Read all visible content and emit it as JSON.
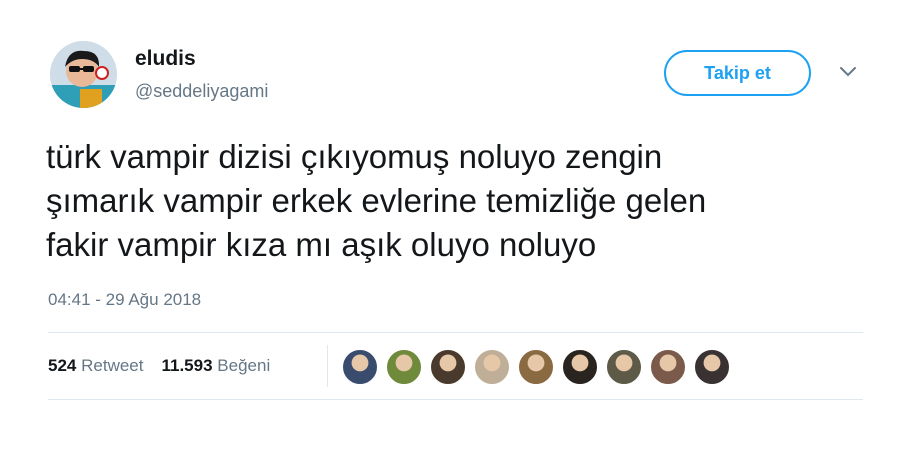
{
  "user": {
    "name": "eludis",
    "handle": "@seddeliyagami"
  },
  "follow_label": "Takip et",
  "tweet": {
    "lines": [
      "türk vampir dizisi çıkıyomuş noluyo zengin",
      "şımarık vampir erkek evlerine temizliğe gelen",
      "fakir vampir kıza mı aşık oluyo noluyo"
    ],
    "timestamp": "04:41 - 29 Ağu 2018"
  },
  "stats": {
    "retweets": "524",
    "retweets_label": "Retweet",
    "likes": "11.593",
    "likes_label": "Beğeni"
  },
  "colors": {
    "accent": "#1da1f2",
    "text": "#14171a",
    "secondary": "#657786"
  },
  "liker_avatars": [
    "#3a4c6e",
    "#6f8a3a",
    "#4a3a2e",
    "#bfae98",
    "#8a6a40",
    "#2a2420",
    "#5e5a48",
    "#7a5a4a",
    "#3a3232"
  ]
}
